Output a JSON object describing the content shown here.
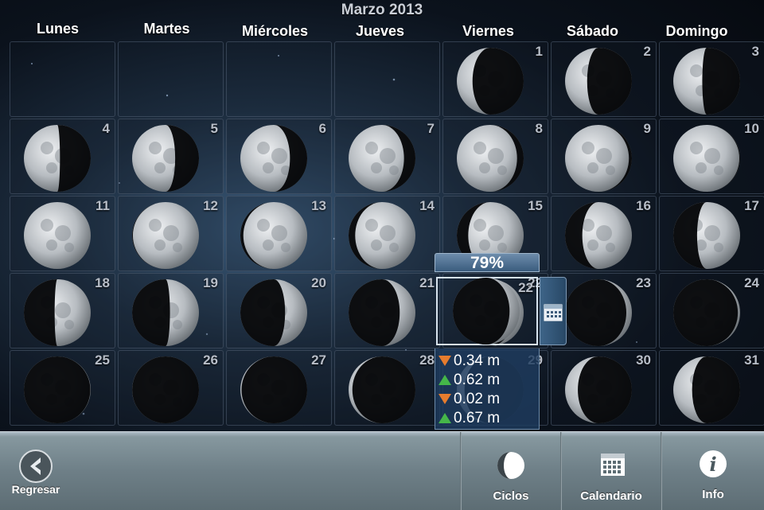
{
  "header": {
    "month_title": "Marzo 2013",
    "weekdays": [
      "Lunes",
      "Martes",
      "Miércoles",
      "Jueves",
      "Viernes",
      "Sábado",
      "Domingo"
    ]
  },
  "calendar": {
    "days": [
      "1",
      "2",
      "3",
      "4",
      "5",
      "6",
      "7",
      "8",
      "9",
      "10",
      "11",
      "12",
      "13",
      "14",
      "15",
      "16",
      "17",
      "18",
      "19",
      "20",
      "21",
      "22",
      "23",
      "24",
      "25",
      "26",
      "27",
      "28",
      "29",
      "30",
      "31"
    ],
    "first_weekday_index": 4,
    "selected_day": "22"
  },
  "selected_popup": {
    "illumination": "79%",
    "tides": [
      {
        "direction": "down",
        "value": "0.34 m"
      },
      {
        "direction": "up",
        "value": "0.62 m"
      },
      {
        "direction": "down",
        "value": "0.02 m"
      },
      {
        "direction": "up",
        "value": "0.67 m"
      }
    ]
  },
  "toolbar": {
    "back_label": "Regresar",
    "cycles_label": "Ciclos",
    "calendar_label": "Calendario",
    "info_label": "Info"
  },
  "colors": {
    "tide_down": "#e67c2e",
    "tide_up": "#45b649",
    "popup_header": "#4f7094"
  },
  "icons": [
    "back-arrow-icon",
    "moon-cycle-icon",
    "calendar-icon",
    "info-icon"
  ]
}
